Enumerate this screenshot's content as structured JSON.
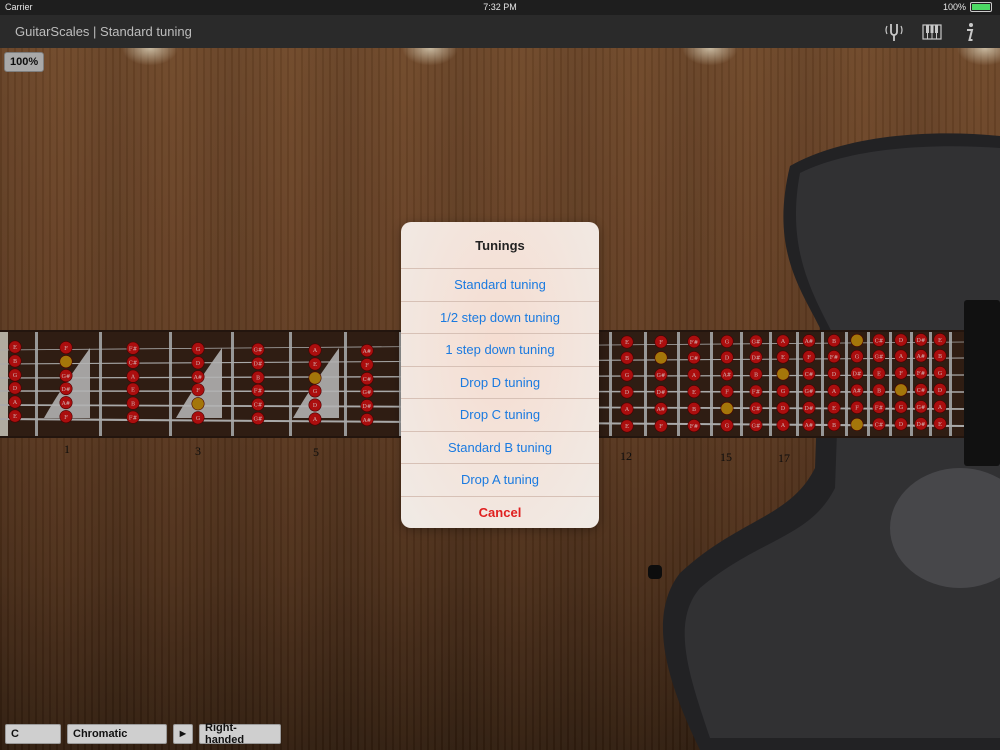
{
  "status_bar": {
    "carrier": "Carrier",
    "time": "7:32 PM",
    "battery": "100%"
  },
  "nav": {
    "title": "GuitarScales | Standard tuning",
    "icons": [
      "tuning-fork-icon",
      "piano-keys-icon",
      "info-icon"
    ]
  },
  "zoom": "100%",
  "fretboard": {
    "fret_numbers": [
      "1",
      "3",
      "5",
      "12",
      "15",
      "17"
    ],
    "notes_left": [
      [
        "E",
        "B",
        "G",
        "D",
        "A",
        "E"
      ],
      [
        "F",
        "C",
        "G#",
        "D#",
        "A#",
        "F"
      ],
      [
        "F#",
        "C#",
        "A",
        "E",
        "B",
        "F#"
      ],
      [
        "G",
        "D",
        "A#",
        "F",
        "C",
        "G"
      ],
      [
        "G#",
        "D#",
        "B",
        "F#",
        "C#",
        "G#"
      ],
      [
        "A",
        "E",
        "C",
        "G",
        "D",
        "A"
      ],
      [
        "A#",
        "F",
        "C#",
        "G#",
        "D#",
        "A#"
      ]
    ],
    "notes_right": [
      [
        "E",
        "B",
        "G",
        "D",
        "A",
        "E"
      ],
      [
        "F",
        "C",
        "G#",
        "D#",
        "A#",
        "F"
      ],
      [
        "F#",
        "C#",
        "A",
        "E",
        "B",
        "F#"
      ],
      [
        "G",
        "D",
        "A#",
        "F",
        "C",
        "G"
      ],
      [
        "G#",
        "D#",
        "B",
        "F#",
        "C#",
        "G#"
      ],
      [
        "A",
        "E",
        "C",
        "G",
        "D",
        "A"
      ],
      [
        "A#",
        "F",
        "C#",
        "G#",
        "D#",
        "A#"
      ],
      [
        "B",
        "F#",
        "D",
        "A",
        "E",
        "B"
      ],
      [
        "C",
        "G",
        "D#",
        "A#",
        "F",
        "C"
      ],
      [
        "C#",
        "G#",
        "E",
        "B",
        "F#",
        "C#"
      ],
      [
        "D",
        "A",
        "F",
        "C",
        "G",
        "D"
      ],
      [
        "D#",
        "A#",
        "F#",
        "C#",
        "G#",
        "D#"
      ],
      [
        "E",
        "B",
        "G",
        "D",
        "A",
        "E"
      ]
    ],
    "highlight_color": "#c8900d",
    "note_color": "#d11212"
  },
  "sheet": {
    "title": "Tunings",
    "options": [
      "Standard tuning",
      "1/2 step down tuning",
      "1 step down tuning",
      "Drop D tuning",
      "Drop C tuning",
      "Standard B tuning",
      "Drop A tuning"
    ],
    "cancel": "Cancel"
  },
  "bottom_bar": {
    "key": "C",
    "scale": "Chromatic",
    "play": "►",
    "handedness": "Right-handed"
  }
}
